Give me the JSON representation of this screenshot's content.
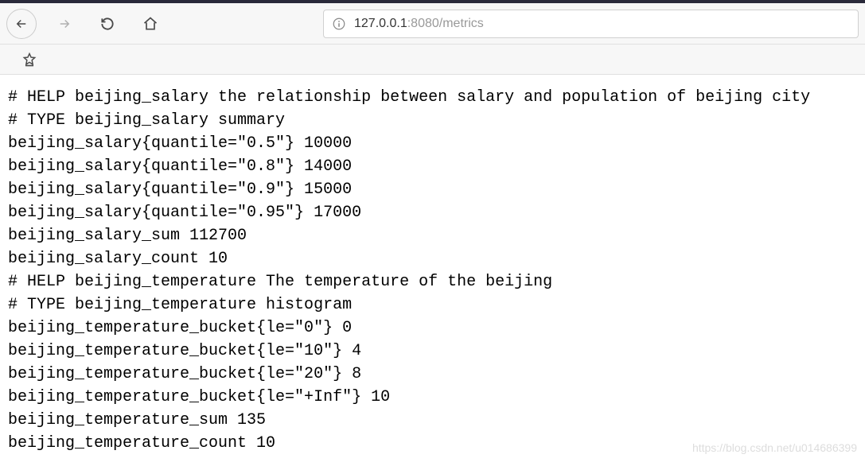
{
  "url": {
    "host": "127.0.0.1",
    "port": ":8080",
    "path": "/metrics"
  },
  "metrics_text": "# HELP beijing_salary the relationship between salary and population of beijing city\n# TYPE beijing_salary summary\nbeijing_salary{quantile=\"0.5\"} 10000\nbeijing_salary{quantile=\"0.8\"} 14000\nbeijing_salary{quantile=\"0.9\"} 15000\nbeijing_salary{quantile=\"0.95\"} 17000\nbeijing_salary_sum 112700\nbeijing_salary_count 10\n# HELP beijing_temperature The temperature of the beijing\n# TYPE beijing_temperature histogram\nbeijing_temperature_bucket{le=\"0\"} 0\nbeijing_temperature_bucket{le=\"10\"} 4\nbeijing_temperature_bucket{le=\"20\"} 8\nbeijing_temperature_bucket{le=\"+Inf\"} 10\nbeijing_temperature_sum 135\nbeijing_temperature_count 10",
  "watermark": "https://blog.csdn.net/u014686399"
}
